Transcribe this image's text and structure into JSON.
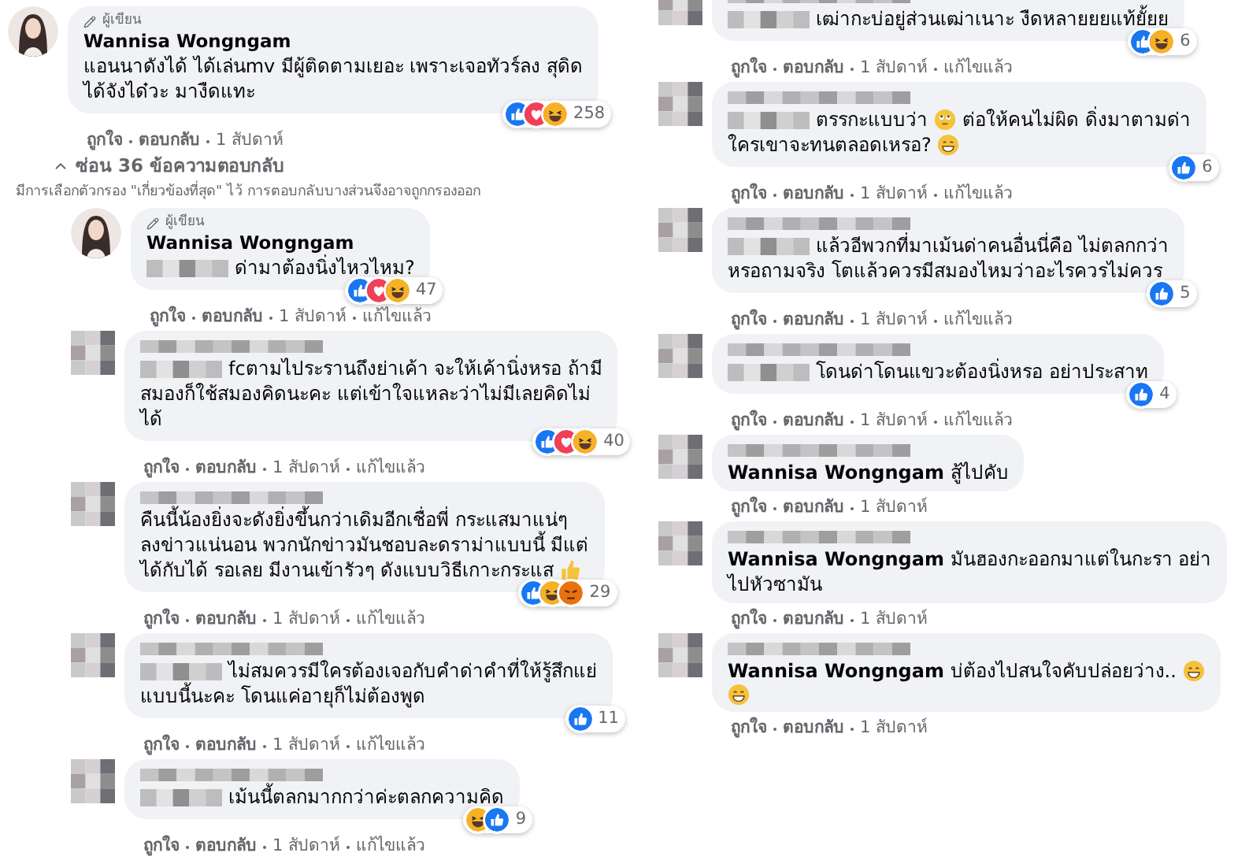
{
  "columns": [
    {
      "comments": [
        {
          "avatar": {
            "kind": "author"
          },
          "author_label": "ผู้เขียน",
          "name": "Wannisa Wongngam",
          "lines": [
            [
              {
                "kind": "text",
                "text": "แอนนาดังได้ ได้เล่นmv มีผู้ติดตามเยอะ เพราะเจอทัวร์ลง สุดิด"
              }
            ],
            [
              {
                "kind": "text",
                "text": "ได้จังได๋วะ มางืดแทะ"
              }
            ]
          ],
          "reactions": {
            "icons": [
              {
                "kind": "like"
              },
              {
                "kind": "love"
              },
              {
                "kind": "haha"
              }
            ],
            "count": "258"
          },
          "actions": [
            "ถูกใจ",
            "ตอบกลับ",
            "1 สัปดาห์"
          ]
        }
      ],
      "replies_toggle": "ซ่อน 36 ข้อความตอบกลับ",
      "filter_notice": "มีการเลือกตัวกรอง \"เกี่ยวข้องที่สุด\" ไว้ การตอบกลับบางส่วนจึงอาจถูกกรองออก",
      "replies": [
        {
          "avatar": {
            "kind": "author"
          },
          "author_label": "ผู้เขียน",
          "name": "Wannisa Wongngam",
          "lines": [
            [
              {
                "kind": "redacted"
              },
              {
                "kind": "text",
                "text": "ด่ามาต้องนิ่งไหวไหม?"
              }
            ]
          ],
          "reactions": {
            "icons": [
              {
                "kind": "like"
              },
              {
                "kind": "love"
              },
              {
                "kind": "haha"
              }
            ],
            "count": "47"
          },
          "actions": [
            "ถูกใจ",
            "ตอบกลับ",
            "1 สัปดาห์",
            "แก้ไขแล้ว"
          ]
        },
        {
          "avatar": {
            "kind": "blurred"
          },
          "lines": [
            [
              {
                "kind": "redacted"
              },
              {
                "kind": "text",
                "text": "fcตามไประรานถึงย่าเค้า จะให้เค้านิ่งหรอ ถ้ามี"
              }
            ],
            [
              {
                "kind": "text",
                "text": "สมองก็ใช้สมองคิดนะคะ แต่เข้าใจแหละว่าไม่มีเลยคิดไม่"
              }
            ],
            [
              {
                "kind": "text",
                "text": "ได้"
              }
            ]
          ],
          "reactions": {
            "icons": [
              {
                "kind": "like"
              },
              {
                "kind": "love"
              },
              {
                "kind": "haha"
              }
            ],
            "count": "40"
          },
          "actions": [
            "ถูกใจ",
            "ตอบกลับ",
            "1 สัปดาห์",
            "แก้ไขแล้ว"
          ]
        },
        {
          "avatar": {
            "kind": "blurred"
          },
          "lines": [
            [
              {
                "kind": "text",
                "text": "คืนนี้น้องยิ่งจะดังยิ่งขึ้นกว่าเดิมอีกเชื่อพี่ กระแสมาแน่ๆ"
              }
            ],
            [
              {
                "kind": "text",
                "text": "ลงข่าวแน่นอน พวกนักข่าวมันชอบละดราม่าแบบนี้ มีแต่"
              }
            ],
            [
              {
                "kind": "text",
                "text": "ได้กับได้ รอเลย มีงานเข้ารัวๆ ดังแบบวิธีเกาะกระแส"
              },
              {
                "kind": "thumb"
              }
            ]
          ],
          "reactions": {
            "icons": [
              {
                "kind": "like"
              },
              {
                "kind": "haha"
              },
              {
                "kind": "angry"
              }
            ],
            "count": "29"
          },
          "actions": [
            "ถูกใจ",
            "ตอบกลับ",
            "1 สัปดาห์",
            "แก้ไขแล้ว"
          ]
        },
        {
          "avatar": {
            "kind": "blurred"
          },
          "lines": [
            [
              {
                "kind": "redacted"
              },
              {
                "kind": "text",
                "text": "ไม่สมควรมีใครต้องเจอกับคำด่าคำที่ให้รู้สึกแย่"
              }
            ],
            [
              {
                "kind": "text",
                "text": "แบบนี้นะคะ โดนแค่อายุก็ไม่ต้องพูด"
              }
            ]
          ],
          "reactions": {
            "icons": [
              {
                "kind": "like"
              }
            ],
            "count": "11"
          },
          "actions": [
            "ถูกใจ",
            "ตอบกลับ",
            "1 สัปดาห์",
            "แก้ไขแล้ว"
          ]
        },
        {
          "avatar": {
            "kind": "blurred"
          },
          "lines": [
            [
              {
                "kind": "redacted"
              },
              {
                "kind": "text",
                "text": "เม้นนี้ตลกมากกว่าค่ะตลกความคิด"
              }
            ]
          ],
          "reactions": {
            "icons": [
              {
                "kind": "haha"
              },
              {
                "kind": "like"
              }
            ],
            "count": "9"
          },
          "actions": [
            "ถูกใจ",
            "ตอบกลับ",
            "1 สัปดาห์",
            "แก้ไขแล้ว"
          ]
        }
      ]
    },
    {
      "replies": [
        {
          "avatar": {
            "kind": "blurred"
          },
          "lines": [
            [
              {
                "kind": "redacted"
              },
              {
                "kind": "text",
                "text": "เฒ่ากะบ่อยู่ส่วนเฒ่าเนาะ งืดหลายยยแท้ยั้ยย"
              }
            ]
          ],
          "reactions": {
            "icons": [
              {
                "kind": "like"
              },
              {
                "kind": "haha"
              }
            ],
            "count": "6"
          },
          "actions": [
            "ถูกใจ",
            "ตอบกลับ",
            "1 สัปดาห์",
            "แก้ไขแล้ว"
          ]
        },
        {
          "avatar": {
            "kind": "blurred"
          },
          "lines": [
            [
              {
                "kind": "redacted"
              },
              {
                "kind": "text",
                "text": "ตรรกะแบบว่า"
              },
              {
                "kind": "roll"
              },
              {
                "kind": "text",
                "text": "ต่อให้คนไม่ผิด ดิ่งมาตามด่า"
              }
            ],
            [
              {
                "kind": "text",
                "text": "ใครเขาจะทนตลอดเหรอ?"
              },
              {
                "kind": "grin"
              }
            ]
          ],
          "reactions": {
            "icons": [
              {
                "kind": "like"
              }
            ],
            "count": "6"
          },
          "actions": [
            "ถูกใจ",
            "ตอบกลับ",
            "1 สัปดาห์",
            "แก้ไขแล้ว"
          ]
        },
        {
          "avatar": {
            "kind": "blurred"
          },
          "lines": [
            [
              {
                "kind": "redacted"
              },
              {
                "kind": "text",
                "text": "แล้วอีพวกที่มาเม้นด่าคนอื่นนี่คือ ไม่ตลกกว่า"
              }
            ],
            [
              {
                "kind": "text",
                "text": "หรอถามจริง โตแล้วควรมีสมองไหมว่าอะไรควรไม่ควร"
              }
            ]
          ],
          "reactions": {
            "icons": [
              {
                "kind": "like"
              }
            ],
            "count": "5"
          },
          "actions": [
            "ถูกใจ",
            "ตอบกลับ",
            "1 สัปดาห์",
            "แก้ไขแล้ว"
          ]
        },
        {
          "avatar": {
            "kind": "blurred"
          },
          "lines": [
            [
              {
                "kind": "redacted"
              },
              {
                "kind": "text",
                "text": "โดนด่าโดนแขวะต้องนิ่งหรอ อย่าประสาท"
              }
            ]
          ],
          "reactions": {
            "icons": [
              {
                "kind": "like"
              }
            ],
            "count": "4"
          },
          "actions": [
            "ถูกใจ",
            "ตอบกลับ",
            "1 สัปดาห์",
            "แก้ไขแล้ว"
          ]
        },
        {
          "avatar": {
            "kind": "blurred"
          },
          "lines": [
            [
              {
                "kind": "text",
                "text": "**Wannisa Wongngam** สู้ไปคับ"
              }
            ]
          ],
          "actions": [
            "ถูกใจ",
            "ตอบกลับ",
            "1 สัปดาห์"
          ]
        },
        {
          "avatar": {
            "kind": "blurred"
          },
          "lines": [
            [
              {
                "kind": "text",
                "text": "**Wannisa Wongngam** มันฮองกะออกมาแต่ในกะรา อย่า"
              }
            ],
            [
              {
                "kind": "text",
                "text": "ไปหัวซามัน"
              }
            ]
          ],
          "actions": [
            "ถูกใจ",
            "ตอบกลับ",
            "1 สัปดาห์"
          ]
        },
        {
          "avatar": {
            "kind": "blurred"
          },
          "lines": [
            [
              {
                "kind": "text",
                "text": "**Wannisa Wongngam** บ่ต้องไปสนใจคับปล่อยว่าง.."
              },
              {
                "kind": "grin"
              }
            ],
            [
              {
                "kind": "grin"
              }
            ]
          ],
          "actions": [
            "ถูกใจ",
            "ตอบกลับ",
            "1 สัปดาห์"
          ]
        }
      ]
    }
  ]
}
